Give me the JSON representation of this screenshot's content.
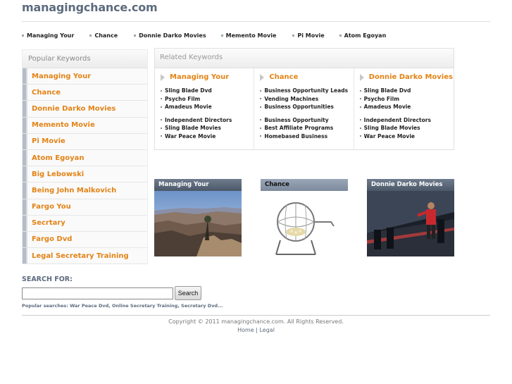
{
  "site": {
    "title": "managingchance.com"
  },
  "top_nav": [
    "Managing Your",
    "Chance",
    "Donnie Darko Movies",
    "Memento Movie",
    "Pi Movie",
    "Atom Egoyan"
  ],
  "popular_keywords": {
    "heading": "Popular Keywords",
    "items": [
      "Managing Your",
      "Chance",
      "Donnie Darko Movies",
      "Memento Movie",
      "Pi Movie",
      "Atom Egoyan",
      "Big Lebowski",
      "Being John Malkovich",
      "Fargo You",
      "Secrtary",
      "Fargo Dvd",
      "Legal Secretary Training"
    ]
  },
  "related_keywords": {
    "heading": "Related Keywords",
    "columns": [
      {
        "title": "Managing Your",
        "group1": [
          "Sling Blade Dvd",
          "Psycho Film",
          "Amadeus Movie"
        ],
        "group2": [
          "Independent Directors",
          "Sling Blade Movies",
          "War Peace Movie"
        ]
      },
      {
        "title": "Chance",
        "group1": [
          "Business Opportunity Leads",
          "Vending Machines",
          "Business Opportunities"
        ],
        "group2": [
          "Business Opportunity",
          "Best Affiliate Programs",
          "Homebased Business"
        ]
      },
      {
        "title": "Donnie Darko Movies",
        "group1": [
          "Sling Blade Dvd",
          "Psycho Film",
          "Amadeus Movie"
        ],
        "group2": [
          "Independent Directors",
          "Sling Blade Movies",
          "War Peace Movie"
        ]
      }
    ]
  },
  "thumbnails": [
    {
      "title": "Managing Your",
      "image": "canyon-landscape-photo"
    },
    {
      "title": "Chance",
      "image": "lottery-bingo-cage-photo"
    },
    {
      "title": "Donnie Darko Movies",
      "image": "man-in-red-jacket-photo"
    }
  ],
  "search": {
    "label": "SEARCH FOR:",
    "value": "",
    "button": "Search",
    "popular": "Popular searches: War Peace Dvd, Online Secretary Training, Secretary Dvd..."
  },
  "footer": {
    "copyright": "Copyright © 2011 managingchance.com. All Rights Reserved.",
    "home": "Home",
    "separator": " | ",
    "legal": "Legal"
  },
  "colors": {
    "accent": "#e38316",
    "title": "#5d6b7e",
    "bar": "#b4bcc8"
  }
}
